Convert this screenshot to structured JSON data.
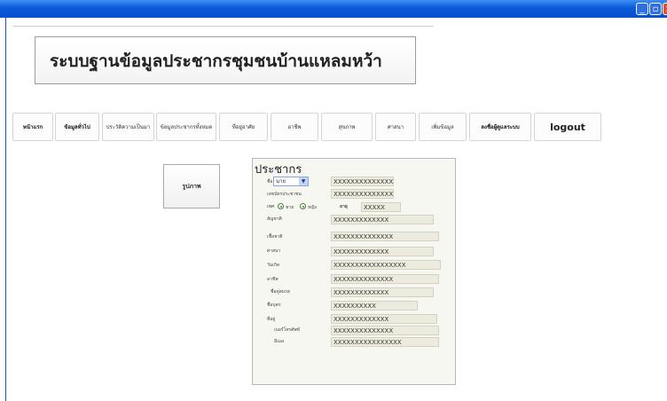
{
  "window": {
    "controls": [
      {
        "name": "minimize",
        "glyph": "_"
      },
      {
        "name": "maximize",
        "glyph": "▫"
      },
      {
        "name": "close",
        "glyph": "×"
      }
    ]
  },
  "header": {
    "title": "ระบบฐานข้อมูลประชากรชุมชนบ้านแหลมหว้า"
  },
  "nav": {
    "items": [
      {
        "label": "หน้าแรก",
        "bold": true
      },
      {
        "label": "ข้อมูลทั่วไป",
        "bold": true
      },
      {
        "label": "ประวัติความเป็นมา",
        "bold": false
      },
      {
        "label": "ข้อมูลประชากรทั้งหมด",
        "bold": false
      },
      {
        "label": "ที่อยู่อาศัย",
        "bold": false
      },
      {
        "label": "อาชีพ",
        "bold": false
      },
      {
        "label": "สุขภาพ",
        "bold": false
      },
      {
        "label": "ศาสนา",
        "bold": false
      },
      {
        "label": "เพิ่มข้อมูล",
        "bold": false
      },
      {
        "label": "ลงชื่อผู้ดูแลระบบ",
        "bold": true
      },
      {
        "label": "logout",
        "bold": true
      }
    ]
  },
  "photo_button": {
    "label": "รูปภาพ"
  },
  "form": {
    "title": "ประชากร",
    "prefix_label": "ชื่อ",
    "prefix_value": "นาย",
    "gender_label": "เพศ",
    "gender_options": [
      "ชาย",
      "หญิง"
    ],
    "age_label": "อายุ",
    "age_value": "XXXXX",
    "rows": [
      {
        "label": "ชื่อ",
        "value": "XXXXXXXXXXXXXX"
      },
      {
        "label": "เลขบัตรประชาชน",
        "value": "XXXXXXXXXXXXXX"
      },
      {
        "label": "เพศ",
        "value": ""
      },
      {
        "label": "สัญชาติ",
        "value": "XXXXXXXXXXXXX"
      },
      {
        "label": "เชื้อชาติ",
        "value": "XXXXXXXXXXXXXX"
      },
      {
        "label": "ศาสนา",
        "value": "XXXXXXXXXXXXX"
      },
      {
        "label": "วันเกิด",
        "value": "XXXXXXXXXXXXXXXXX"
      },
      {
        "label": "อาชีพ",
        "value": "XXXXXXXXXXXXXX"
      },
      {
        "label": "ชื่อคู่สมรส",
        "value": "XXXXXXXXXXXXX"
      },
      {
        "label": "ชื่อบุตร",
        "value": "XXXXXXXXXX"
      },
      {
        "label": "ที่อยู่",
        "value": "XXXXXXXXXXXXX"
      },
      {
        "label": "เบอร์โทรศัพท์",
        "value": "XXXXXXXXXXXXXX"
      },
      {
        "label": "อีเมล",
        "value": "XXXXXXXXXXXXXXXX"
      }
    ]
  },
  "colors": {
    "titlebar": "#0a5ad8",
    "field_bg": "#ecebde",
    "panel_bg": "#f7f7f1"
  }
}
